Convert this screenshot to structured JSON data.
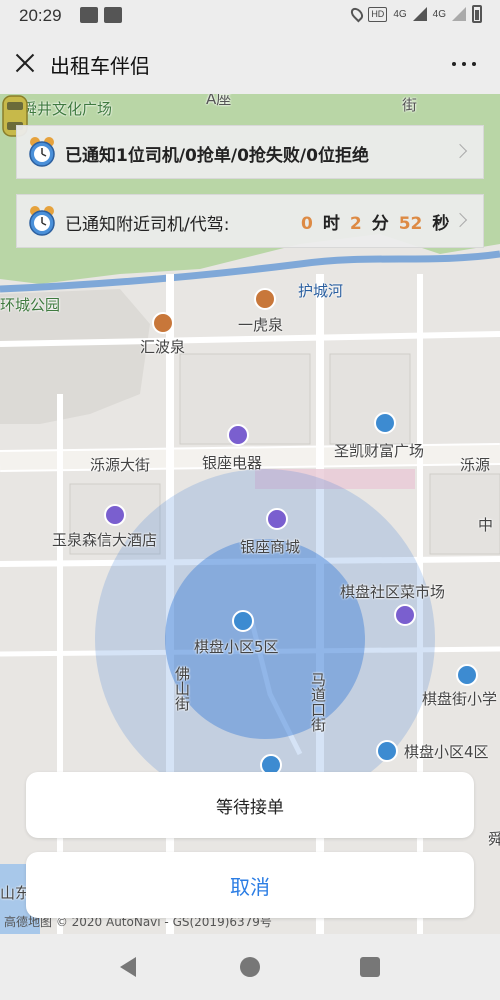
{
  "status_bar": {
    "time": "20:29",
    "network_1": "4G",
    "network_2": "4G",
    "hd": "HD"
  },
  "header": {
    "title": "出租车伴侣"
  },
  "map": {
    "labels": {
      "shunjing_square": "舜井文化广场",
      "a_zuo": "A座",
      "jie_top": "街",
      "huancheng_park": "环城公园",
      "hucheng_river": "护城河",
      "yihu_spring": "一虎泉",
      "huibo_spring": "汇波泉",
      "luoyuan_street": "泺源大街",
      "luoyuan_street_right": "泺源",
      "yinzuo_electric": "银座电器",
      "shengkai_plaza": "圣凯财富广场",
      "yuquan_hotel": "玉泉森信大酒店",
      "yinzuo_mall": "银座商城",
      "qipan_market": "棋盘社区菜市场",
      "qipan_5": "棋盘小区5区",
      "foshan_street": "佛山街",
      "madaokou_street": "马道口街",
      "qipan_school": "棋盘街小学",
      "qipan_4": "棋盘小区4区",
      "zhong": "中",
      "dong": "山东",
      "ba": "舜",
      "credit": "高德地图 © 2020 AutoNavi - GS(2019)6379号"
    }
  },
  "notifications": {
    "summary": "已通知1位司机/0抢单/0抢失败/0位拒绝",
    "nearby_label": "已通知附近司机/代驾:",
    "countdown": {
      "hours": "0",
      "hours_unit": "时",
      "minutes": "2",
      "minutes_unit": "分",
      "seconds": "52",
      "seconds_unit": "秒"
    }
  },
  "sheet": {
    "status": "等待接单",
    "cancel": "取消"
  },
  "colors": {
    "accent_blue": "#2b7de4",
    "countdown_orange": "#dd8a44",
    "radius_blue": "#3f7fd6"
  }
}
